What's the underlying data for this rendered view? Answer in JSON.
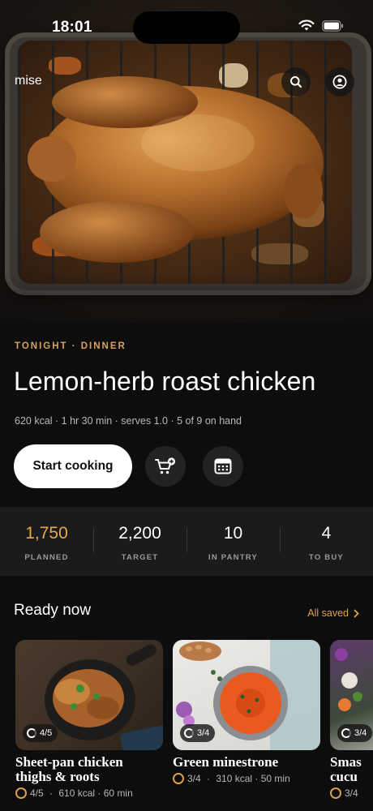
{
  "status_bar": {
    "time": "18:01"
  },
  "header": {
    "brand": "mise",
    "search_icon": "search-icon",
    "profile_icon": "user-circle-icon"
  },
  "recipe": {
    "kicker": "TONIGHT · DINNER",
    "title": "Lemon-herb roast chicken",
    "meta": "620 kcal · 1 hr 30 min · serves 1.0 · 5 of 9 on hand",
    "cta_label": "Start cooking",
    "cart_icon": "cart-plus-icon",
    "calendar_icon": "calendar-icon"
  },
  "stats": [
    {
      "value": "1,750",
      "label": "PLANNED",
      "accent": true
    },
    {
      "value": "2,200",
      "label": "TARGET",
      "accent": false
    },
    {
      "value": "10",
      "label": "IN PANTRY",
      "accent": false
    },
    {
      "value": "4",
      "label": "TO BUY",
      "accent": false
    }
  ],
  "ready_now": {
    "title": "Ready now",
    "link": "All saved",
    "cards": [
      {
        "badge": "4/5",
        "title_line1": "Sheet-pan chicken",
        "title_line2": "thighs & roots",
        "meta_have": "4/5",
        "meta_rest": "610 kcal · 60 min"
      },
      {
        "badge": "3/4",
        "title_line1": "Green minestrone",
        "title_line2": "",
        "meta_have": "3/4",
        "meta_rest": "310 kcal · 50 min"
      },
      {
        "badge": "3/4",
        "title_line1": "Smas",
        "title_line2": "cucu",
        "meta_have": "3/4",
        "meta_rest": ""
      }
    ]
  },
  "colors": {
    "accent": "#e2a24f",
    "background": "#0d0d0d",
    "panel": "#1b1b1b"
  }
}
